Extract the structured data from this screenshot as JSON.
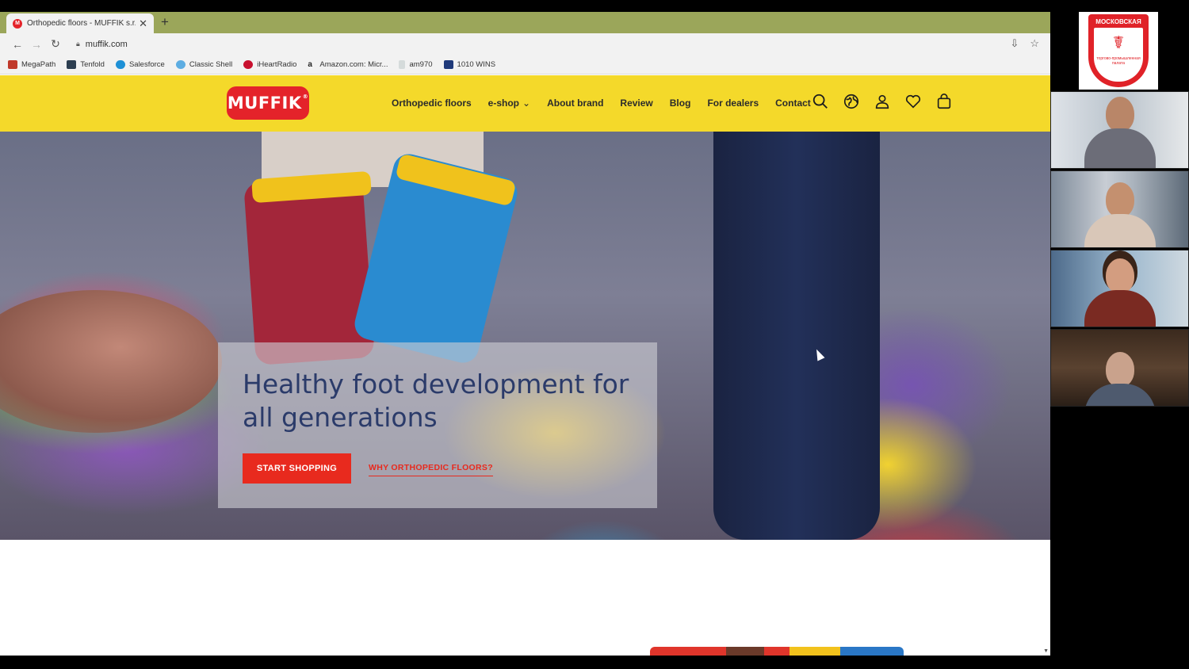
{
  "browser": {
    "tab_title": "Orthopedic floors - MUFFIK s.r.o.",
    "tab_favicon_letter": "M",
    "new_tab_symbol": "+",
    "close_symbol": "✕",
    "url": "muffik.com",
    "bookmarks": [
      {
        "label": "MegaPath",
        "color": "#c0392b"
      },
      {
        "label": "Tenfold",
        "color": "#2c3e50"
      },
      {
        "label": "Salesforce",
        "color": "#1e90d6"
      },
      {
        "label": "Classic Shell",
        "color": "#5dade2"
      },
      {
        "label": "iHeartRadio",
        "color": "#c8102e"
      },
      {
        "label": "Amazon.com: Micr...",
        "color": "#222222"
      },
      {
        "label": "am970",
        "color": "#7f8c8d"
      },
      {
        "label": "1010 WINS",
        "color": "#1f3a7a"
      }
    ]
  },
  "site": {
    "logo": "MUFFIK",
    "logo_mark": "®",
    "menu": [
      "Orthopedic floors",
      "e-shop",
      "About brand",
      "Review",
      "Blog",
      "For dealers",
      "Contact"
    ],
    "menu_dropdown_index": 1,
    "header_icons": [
      "search-icon",
      "globe-icon",
      "user-icon",
      "heart-icon",
      "bag-icon"
    ],
    "header_color": "#f4d92a",
    "accent_color": "#e4232a"
  },
  "hero": {
    "headline": "Healthy foot development for all generations",
    "cta_primary": "START SHOPPING",
    "cta_secondary": "WHY ORTHOPEDIC FLOORS?"
  },
  "video_call": {
    "logo_title": "МОСКОВСКАЯ",
    "logo_subtitle": "торгово-промышленная палата",
    "participants": 4
  }
}
